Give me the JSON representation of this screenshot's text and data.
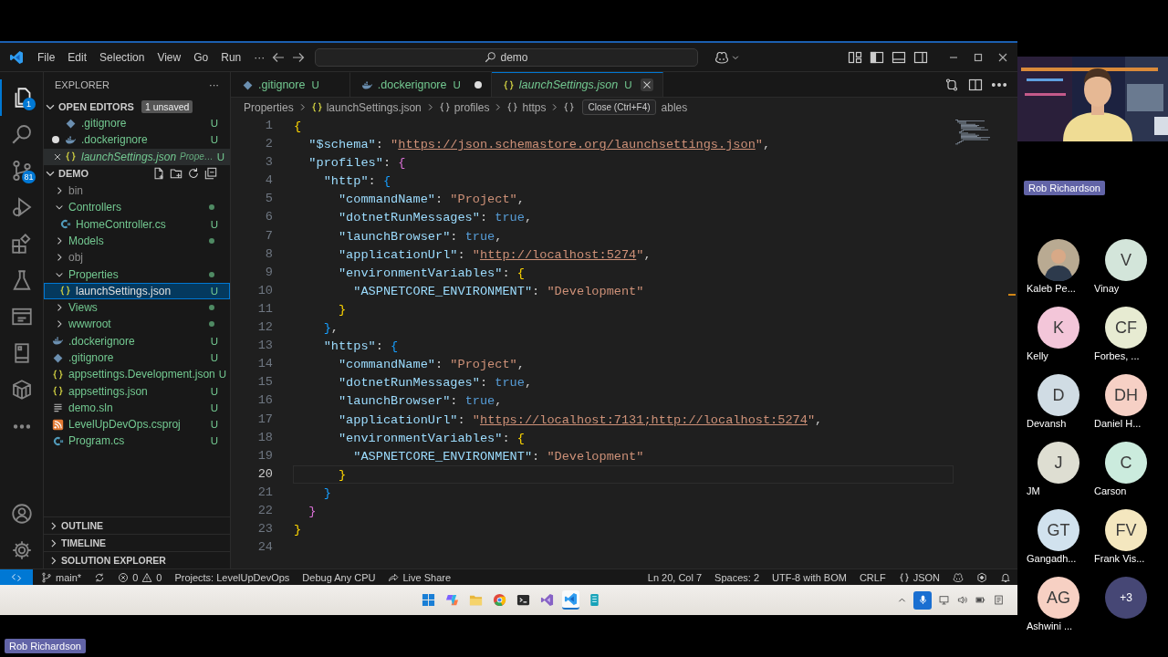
{
  "window": {
    "menu": [
      "File",
      "Edit",
      "Selection",
      "View",
      "Go",
      "Run",
      "···"
    ],
    "search": "demo"
  },
  "activity_bar": [
    {
      "kind": "files",
      "selected": true,
      "badge": "1"
    },
    {
      "kind": "search",
      "selected": false
    },
    {
      "kind": "branch",
      "selected": false,
      "badge": "81"
    },
    {
      "kind": "run",
      "selected": false
    },
    {
      "kind": "blocks",
      "selected": false
    },
    {
      "kind": "flask",
      "selected": false
    },
    {
      "kind": "window",
      "selected": false
    },
    {
      "kind": "tablet",
      "selected": false
    },
    {
      "kind": "cube",
      "selected": false
    },
    {
      "kind": "dots",
      "selected": false
    }
  ],
  "sidebar": {
    "title": "EXPLORER",
    "more": "···",
    "open_editors": {
      "title": "OPEN EDITORS",
      "badge": "1 unsaved",
      "items": [
        {
          "label": ".gitignore",
          "kind": "git",
          "badge": "U",
          "dirty": false,
          "active": false
        },
        {
          "label": ".dockerignore",
          "kind": "docker",
          "badge": "U",
          "dirty": true,
          "active": false
        },
        {
          "label": "launchSettings.json",
          "kind": "json",
          "description": "Prope…",
          "badge": "U",
          "dirty": false,
          "active": true
        }
      ]
    },
    "folder": {
      "title": "DEMO",
      "tree": [
        {
          "label": "bin",
          "kind": "folder",
          "ignored": true,
          "expanded": false,
          "dot": false,
          "selected": false
        },
        {
          "label": "Controllers",
          "kind": "folder",
          "ignored": false,
          "expanded": true,
          "dot": true,
          "selected": false,
          "children": [
            {
              "label": "HomeController.cs",
              "kind": "csharp",
              "ignored": false,
              "badge": "U",
              "selected": false
            }
          ]
        },
        {
          "label": "Models",
          "kind": "folder",
          "ignored": false,
          "expanded": false,
          "dot": true,
          "selected": false
        },
        {
          "label": "obj",
          "kind": "folder",
          "ignored": true,
          "expanded": false,
          "dot": false,
          "selected": false
        },
        {
          "label": "Properties",
          "kind": "folder",
          "ignored": false,
          "expanded": true,
          "dot": true,
          "selected": false,
          "children": [
            {
              "label": "launchSettings.json",
              "kind": "json",
              "ignored": false,
              "badge": "U",
              "selected": true
            }
          ]
        },
        {
          "label": "Views",
          "kind": "folder",
          "ignored": false,
          "expanded": false,
          "dot": true,
          "selected": false
        },
        {
          "label": "wwwroot",
          "kind": "folder",
          "ignored": false,
          "expanded": false,
          "dot": true,
          "selected": false
        },
        {
          "label": ".dockerignore",
          "kind": "docker",
          "ignored": false,
          "badge": "U",
          "selected": false
        },
        {
          "label": ".gitignore",
          "kind": "git",
          "ignored": false,
          "badge": "U",
          "selected": false
        },
        {
          "label": "appsettings.Development.json",
          "kind": "json",
          "ignored": false,
          "badge": "U",
          "selected": false
        },
        {
          "label": "appsettings.json",
          "kind": "json",
          "ignored": false,
          "badge": "U",
          "selected": false
        },
        {
          "label": "demo.sln",
          "kind": "sln",
          "ignored": false,
          "badge": "U",
          "selected": false
        },
        {
          "label": "LevelUpDevOps.csproj",
          "kind": "rss",
          "ignored": false,
          "badge": "U",
          "selected": false
        },
        {
          "label": "Program.cs",
          "kind": "csharp",
          "ignored": false,
          "badge": "U",
          "selected": false
        }
      ]
    },
    "panels": [
      "OUTLINE",
      "TIMELINE",
      "SOLUTION EXPLORER"
    ]
  },
  "tabs": [
    {
      "label": ".gitignore",
      "kind": "git",
      "badge": "U",
      "dirty": false,
      "selected": false
    },
    {
      "label": ".dockerignore",
      "kind": "docker",
      "badge": "U",
      "dirty": true,
      "selected": false
    },
    {
      "label": "launchSettings.json",
      "kind": "json",
      "badge": "U",
      "dirty": false,
      "selected": true
    }
  ],
  "breadcrumbs": [
    {
      "label": "Properties"
    },
    {
      "label": "launchSettings.json",
      "kind": "json"
    },
    {
      "label": "profiles",
      "kind": "object"
    },
    {
      "label": "https",
      "kind": "object"
    },
    {
      "label": "ables",
      "kind": "object",
      "tooltip": "Close (Ctrl+F4)"
    }
  ],
  "code": [
    {
      "number": "1",
      "current": false,
      "tokens": [
        {
          "t": "{",
          "kind": "b1"
        }
      ]
    },
    {
      "number": "2",
      "current": false,
      "tokens": [
        {
          "t": "  \"$schema\"",
          "kind": "key"
        },
        {
          "t": ": ",
          "kind": "punct"
        },
        {
          "t": "\"",
          "kind": "string"
        },
        {
          "t": "https://json.schemastore.org/launchsettings.json",
          "kind": "link"
        },
        {
          "t": "\"",
          "kind": "string"
        },
        {
          "t": ",",
          "kind": "punct"
        }
      ]
    },
    {
      "number": "3",
      "current": false,
      "tokens": [
        {
          "t": "  \"profiles\"",
          "kind": "key"
        },
        {
          "t": ": ",
          "kind": "punct"
        },
        {
          "t": "{",
          "kind": "b2"
        }
      ]
    },
    {
      "number": "4",
      "current": false,
      "tokens": [
        {
          "t": "    \"http\"",
          "kind": "key"
        },
        {
          "t": ": ",
          "kind": "punct"
        },
        {
          "t": "{",
          "kind": "b3"
        }
      ]
    },
    {
      "number": "5",
      "current": false,
      "tokens": [
        {
          "t": "      \"commandName\"",
          "kind": "key"
        },
        {
          "t": ": ",
          "kind": "punct"
        },
        {
          "t": "\"Project\"",
          "kind": "string"
        },
        {
          "t": ",",
          "kind": "punct"
        }
      ]
    },
    {
      "number": "6",
      "current": false,
      "tokens": [
        {
          "t": "      \"dotnetRunMessages\"",
          "kind": "key"
        },
        {
          "t": ": ",
          "kind": "punct"
        },
        {
          "t": "true",
          "kind": "bool"
        },
        {
          "t": ",",
          "kind": "punct"
        }
      ]
    },
    {
      "number": "7",
      "current": false,
      "tokens": [
        {
          "t": "      \"launchBrowser\"",
          "kind": "key"
        },
        {
          "t": ": ",
          "kind": "punct"
        },
        {
          "t": "true",
          "kind": "bool"
        },
        {
          "t": ",",
          "kind": "punct"
        }
      ]
    },
    {
      "number": "8",
      "current": false,
      "tokens": [
        {
          "t": "      \"applicationUrl\"",
          "kind": "key"
        },
        {
          "t": ": ",
          "kind": "punct"
        },
        {
          "t": "\"",
          "kind": "string"
        },
        {
          "t": "http://localhost:5274",
          "kind": "link"
        },
        {
          "t": "\"",
          "kind": "string"
        },
        {
          "t": ",",
          "kind": "punct"
        }
      ]
    },
    {
      "number": "9",
      "current": false,
      "tokens": [
        {
          "t": "      \"environmentVariables\"",
          "kind": "key"
        },
        {
          "t": ": ",
          "kind": "punct"
        },
        {
          "t": "{",
          "kind": "b1"
        }
      ]
    },
    {
      "number": "10",
      "current": false,
      "tokens": [
        {
          "t": "        \"ASPNETCORE_ENVIRONMENT\"",
          "kind": "key"
        },
        {
          "t": ": ",
          "kind": "punct"
        },
        {
          "t": "\"Development\"",
          "kind": "string"
        }
      ]
    },
    {
      "number": "11",
      "current": false,
      "tokens": [
        {
          "t": "      }",
          "kind": "b1"
        }
      ]
    },
    {
      "number": "12",
      "current": false,
      "tokens": [
        {
          "t": "    }",
          "kind": "b3"
        },
        {
          "t": ",",
          "kind": "punct"
        }
      ]
    },
    {
      "number": "13",
      "current": false,
      "tokens": [
        {
          "t": "    \"https\"",
          "kind": "key"
        },
        {
          "t": ": ",
          "kind": "punct"
        },
        {
          "t": "{",
          "kind": "b3"
        }
      ]
    },
    {
      "number": "14",
      "current": false,
      "tokens": [
        {
          "t": "      \"commandName\"",
          "kind": "key"
        },
        {
          "t": ": ",
          "kind": "punct"
        },
        {
          "t": "\"Project\"",
          "kind": "string"
        },
        {
          "t": ",",
          "kind": "punct"
        }
      ]
    },
    {
      "number": "15",
      "current": false,
      "tokens": [
        {
          "t": "      \"dotnetRunMessages\"",
          "kind": "key"
        },
        {
          "t": ": ",
          "kind": "punct"
        },
        {
          "t": "true",
          "kind": "bool"
        },
        {
          "t": ",",
          "kind": "punct"
        }
      ]
    },
    {
      "number": "16",
      "current": false,
      "tokens": [
        {
          "t": "      \"launchBrowser\"",
          "kind": "key"
        },
        {
          "t": ": ",
          "kind": "punct"
        },
        {
          "t": "true",
          "kind": "bool"
        },
        {
          "t": ",",
          "kind": "punct"
        }
      ]
    },
    {
      "number": "17",
      "current": false,
      "tokens": [
        {
          "t": "      \"applicationUrl\"",
          "kind": "key"
        },
        {
          "t": ": ",
          "kind": "punct"
        },
        {
          "t": "\"",
          "kind": "string"
        },
        {
          "t": "https://localhost:7131;http://localhost:5274",
          "kind": "link"
        },
        {
          "t": "\"",
          "kind": "string"
        },
        {
          "t": ",",
          "kind": "punct"
        }
      ]
    },
    {
      "number": "18",
      "current": false,
      "tokens": [
        {
          "t": "      \"environmentVariables\"",
          "kind": "key"
        },
        {
          "t": ": ",
          "kind": "punct"
        },
        {
          "t": "{",
          "kind": "b1"
        }
      ]
    },
    {
      "number": "19",
      "current": false,
      "tokens": [
        {
          "t": "        \"ASPNETCORE_ENVIRONMENT\"",
          "kind": "key"
        },
        {
          "t": ": ",
          "kind": "punct"
        },
        {
          "t": "\"Development\"",
          "kind": "string"
        }
      ]
    },
    {
      "number": "20",
      "current": true,
      "tokens": [
        {
          "t": "      }",
          "kind": "b1"
        }
      ]
    },
    {
      "number": "21",
      "current": false,
      "tokens": [
        {
          "t": "    }",
          "kind": "b3"
        }
      ]
    },
    {
      "number": "22",
      "current": false,
      "tokens": [
        {
          "t": "  }",
          "kind": "b2"
        }
      ]
    },
    {
      "number": "23",
      "current": false,
      "tokens": [
        {
          "t": "}",
          "kind": "b1"
        }
      ]
    },
    {
      "number": "24",
      "current": false
    }
  ],
  "status_bar": {
    "left": [
      {
        "kind": "remote"
      },
      {
        "kind": "branch",
        "label": "main*"
      },
      {
        "kind": "sync"
      },
      {
        "kind": "problems",
        "errors": "0",
        "warnings": "0"
      },
      {
        "kind": "text",
        "label": "Projects: LevelUpDevOps"
      },
      {
        "kind": "text",
        "label": "Debug Any CPU"
      },
      {
        "kind": "liveshare",
        "label": "Live Share"
      }
    ],
    "right": [
      {
        "kind": "text",
        "label": "Ln 20, Col 7"
      },
      {
        "kind": "text",
        "label": "Spaces: 2"
      },
      {
        "kind": "text",
        "label": "UTF-8 with BOM"
      },
      {
        "kind": "text",
        "label": "CRLF"
      },
      {
        "kind": "language",
        "label": "JSON"
      },
      {
        "kind": "copilot"
      },
      {
        "kind": "ext"
      },
      {
        "kind": "bell"
      }
    ]
  },
  "taskbar": {
    "apps": [
      {
        "kind": "windows",
        "selected": false
      },
      {
        "kind": "copilot",
        "selected": false
      },
      {
        "kind": "folder",
        "selected": false
      },
      {
        "kind": "chrome",
        "selected": false
      },
      {
        "kind": "terminal",
        "selected": false
      },
      {
        "kind": "vs",
        "selected": false
      },
      {
        "kind": "vscode",
        "selected": true
      },
      {
        "kind": "phone",
        "selected": false
      }
    ],
    "tray": [
      {
        "kind": "chevron",
        "on": false
      },
      {
        "kind": "mic",
        "on": true
      },
      {
        "kind": "monitor",
        "on": false
      },
      {
        "kind": "speaker",
        "on": false
      },
      {
        "kind": "battery",
        "on": false
      },
      {
        "kind": "notes",
        "on": false
      }
    ]
  },
  "meeting": {
    "presenter": {
      "name": "Rob Richardson"
    },
    "participants": [
      {
        "name": "Kaleb Pe..."
      },
      {
        "kind": "initials",
        "initials": "V",
        "name": "Vinay",
        "color": "#d3e5da"
      },
      {
        "kind": "initials",
        "initials": "K",
        "name": "Kelly",
        "color": "#f3c6d9"
      },
      {
        "kind": "initials",
        "initials": "CF",
        "name": "Forbes, ...",
        "color": "#e7ebd2"
      },
      {
        "kind": "initials",
        "initials": "D",
        "name": "Devansh",
        "color": "#d0dce4"
      },
      {
        "kind": "initials",
        "initials": "DH",
        "name": "Daniel H...",
        "color": "#f6d0c5"
      },
      {
        "kind": "initials",
        "initials": "J",
        "name": "JM",
        "color": "#deded2"
      },
      {
        "kind": "initials",
        "initials": "C",
        "name": "Carson",
        "color": "#cbebdd"
      },
      {
        "kind": "initials",
        "initials": "GT",
        "name": "Gangadh...",
        "color": "#d1e2ee"
      },
      {
        "kind": "initials",
        "initials": "FV",
        "name": "Frank Vis...",
        "color": "#f4e7bf"
      },
      {
        "kind": "initials",
        "initials": "AG",
        "name": "Ashwini ...",
        "color": "#f7d0c3"
      },
      {
        "kind": "overflow",
        "initials": "+3",
        "color": "#464775"
      }
    ],
    "sharer_tag": "Rob Richardson"
  }
}
